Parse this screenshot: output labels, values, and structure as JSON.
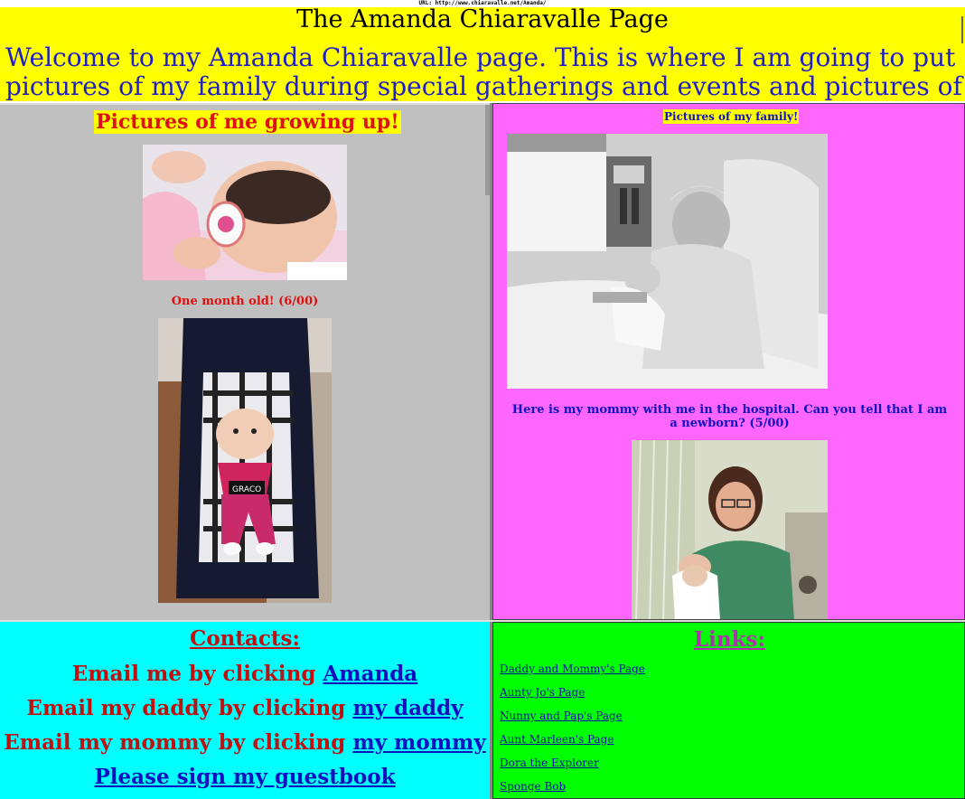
{
  "url_bar": "URL: http://www.chiaravalle.net/Amanda/",
  "header": {
    "title": "The Amanda Chiaravalle Page",
    "welcome_line1": "Welcome to my Amanda Chiaravalle page.  This is where I am going to put",
    "welcome_line2": "pictures of my family during special gatherings and events and pictures of me"
  },
  "growing_up": {
    "title": "Pictures of me growing up!",
    "caption1": "One month old!  (6/00)"
  },
  "family": {
    "title": "Pictures of my family!",
    "caption1": "Here is my mommy with me in the hospital.  Can you tell that I am a newborn? (5/00)"
  },
  "contacts": {
    "title": "Contacts:",
    "email_amanda_prefix": "Email me by clicking ",
    "email_amanda_link": "Amanda",
    "email_daddy_prefix": "Email my daddy by clicking ",
    "email_daddy_link": "my daddy",
    "email_mommy_prefix": "Email my mommy by clicking ",
    "email_mommy_link": "my mommy",
    "guestbook": "Please sign my guestbook"
  },
  "links": {
    "title": "Links:",
    "items": [
      "Daddy and Mommy's Page",
      "Aunty Jo's Page",
      "Nunny and Pap's Page",
      "Aunt Marleen's Page",
      "Dora the Explorer",
      "Sponge Bob"
    ]
  },
  "colors": {
    "header_bg": "#ffff00",
    "growing_bg": "#c0c0c0",
    "family_bg": "#ff66ff",
    "contacts_bg": "#00ffff",
    "links_bg": "#00ff00"
  }
}
